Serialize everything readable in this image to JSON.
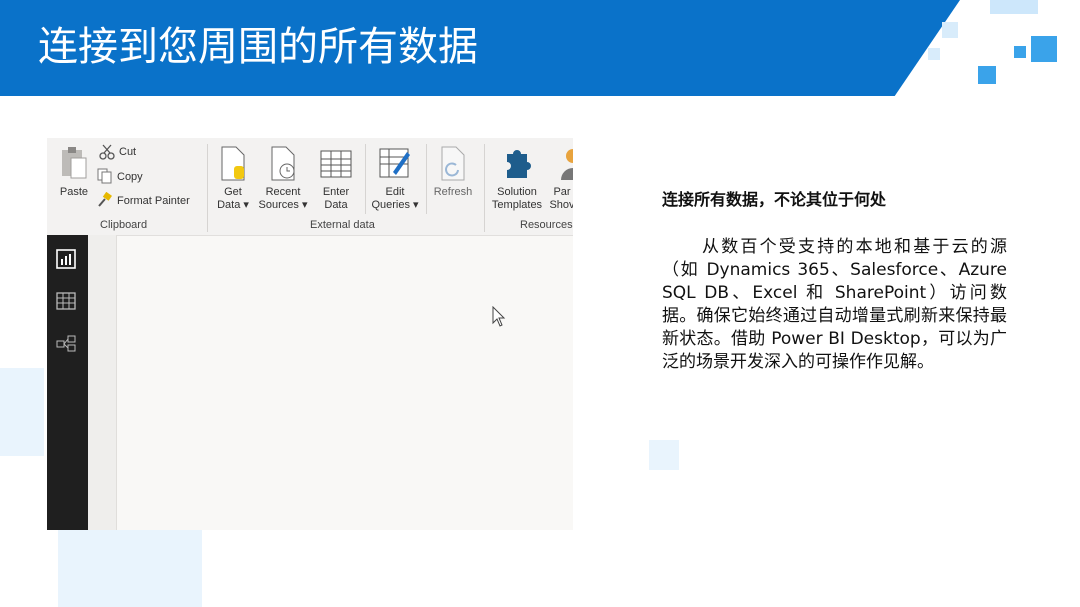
{
  "slide": {
    "title": "连接到您周围的所有数据",
    "heading": "连接所有数据，不论其位于何处",
    "body": "从数百个受支持的本地和基于云的源（如 Dynamics 365、Salesforce、Azure SQL DB、Excel 和 SharePoint）访问数据。确保它始终通过自动增量式刷新来保持最新状态。借助 Power BI Desktop，可以为广泛的场景开发深入的可操作作见解。"
  },
  "ribbon": {
    "clipboard": {
      "paste": "Paste",
      "cut": "Cut",
      "copy": "Copy",
      "format_painter": "Format Painter",
      "group_label": "Clipboard"
    },
    "external_data": {
      "get_data": [
        "Get",
        "Data ▾"
      ],
      "recent_sources": [
        "Recent",
        "Sources ▾"
      ],
      "enter_data": [
        "Enter",
        "Data"
      ],
      "edit_queries": [
        "Edit",
        "Queries ▾"
      ],
      "refresh": "Refresh",
      "group_label": "External data"
    },
    "resources": {
      "solution_templates": [
        "Solution",
        "Templates"
      ],
      "partner_showcase": [
        "Par",
        "Shov"
      ],
      "group_label": "Resources"
    }
  },
  "colors": {
    "banner": "#0a72c9",
    "deco_light": "#e9f4fd",
    "deco_mid": "#3aa3ea",
    "nav_dark": "#1f1f1f"
  }
}
